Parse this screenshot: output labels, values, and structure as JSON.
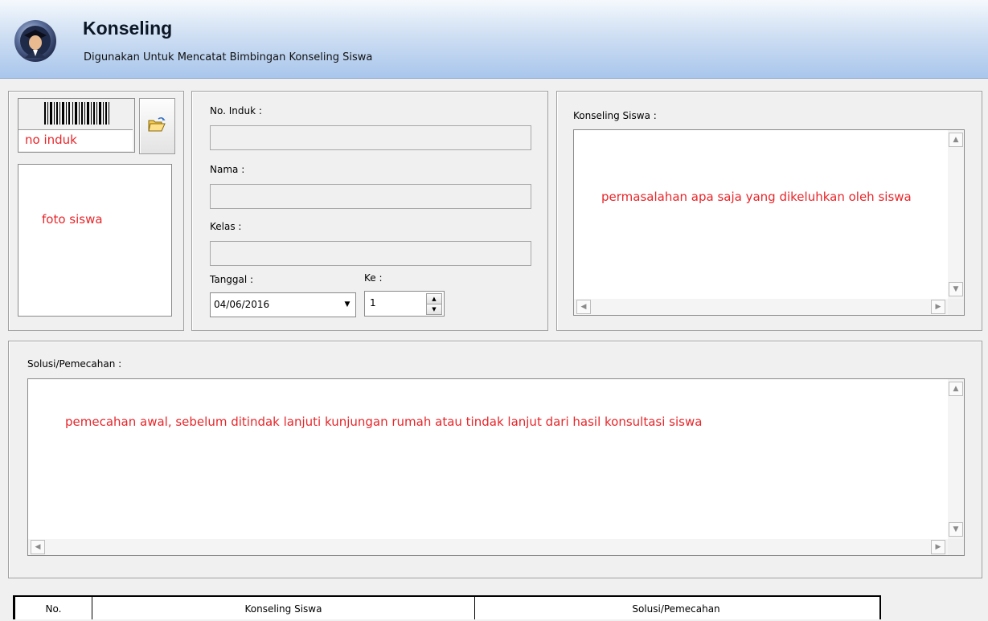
{
  "header": {
    "title": "Konseling",
    "subtitle": "Digunakan Untuk Mencatat Bimbingan Konseling Siswa",
    "icon": "student-graduate-icon"
  },
  "student": {
    "barcode_icon": "barcode-icon",
    "no_induk_hint": "no induk",
    "photo_hint": "foto siswa",
    "open_icon": "folder-open-icon"
  },
  "form": {
    "no_induk_label": "No. Induk :",
    "no_induk_value": "",
    "nama_label": "Nama :",
    "nama_value": "",
    "kelas_label": "Kelas :",
    "kelas_value": "",
    "tanggal_label": "Tanggal :",
    "tanggal_value": "04/06/2016",
    "ke_label": "Ke :",
    "ke_value": "1"
  },
  "konseling": {
    "label": "Konseling Siswa :",
    "text": "permasalahan apa saja yang dikeluhkan oleh siswa"
  },
  "solusi": {
    "label": "Solusi/Pemecahan :",
    "text": "pemecahan awal, sebelum ditindak lanjuti kunjungan rumah atau tindak lanjut dari hasil konsultasi siswa"
  },
  "grid": {
    "columns": [
      "No.",
      "Konseling Siswa",
      "Solusi/Pemecahan"
    ]
  },
  "colors": {
    "hint_red": "#e8262a",
    "header_gradient_bottom": "#a9c6ec"
  }
}
